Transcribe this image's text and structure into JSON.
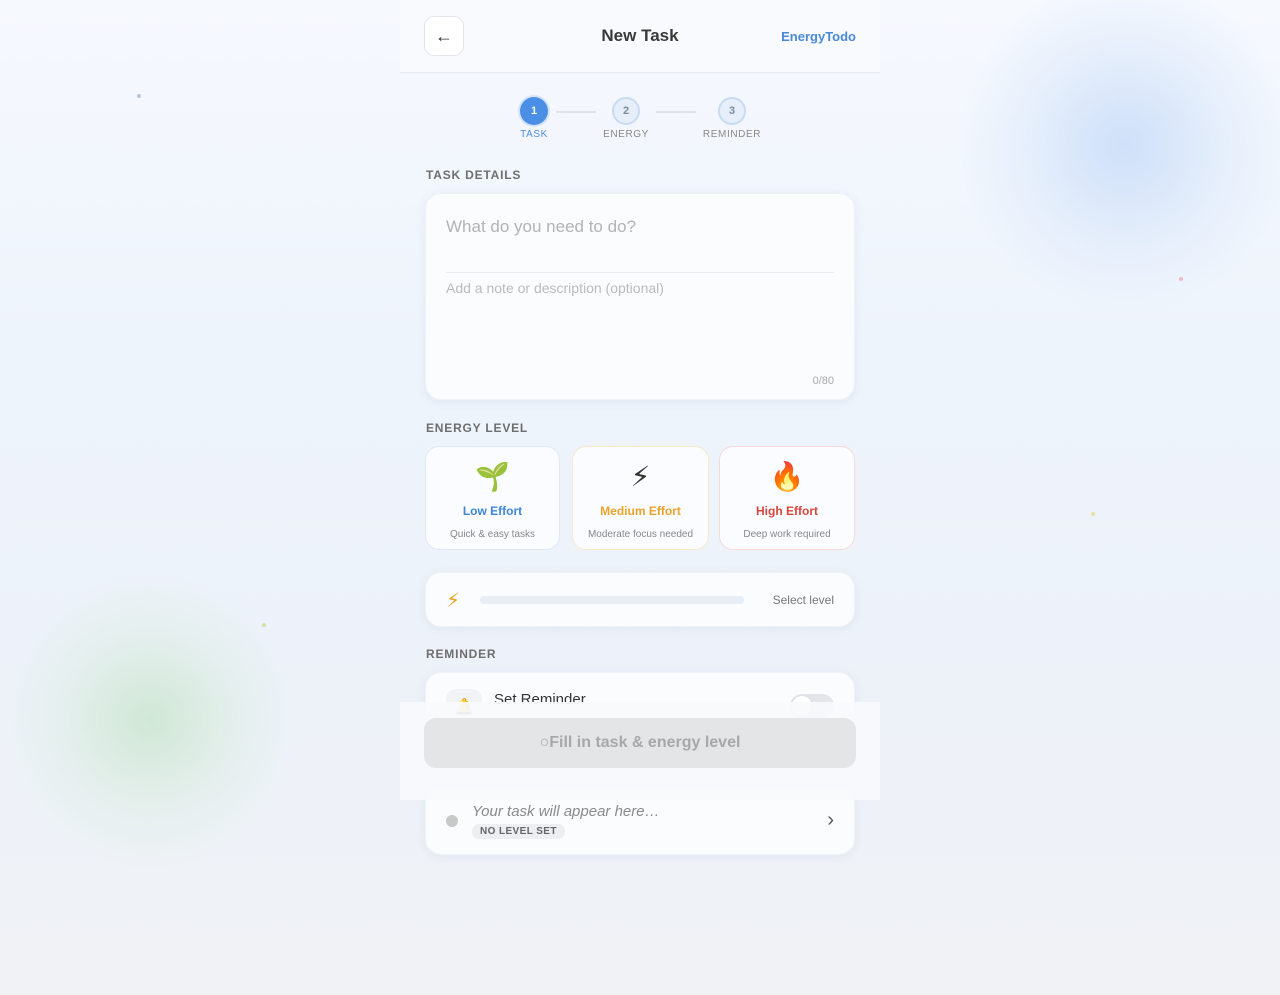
{
  "header": {
    "title": "New Task",
    "brand": "EnergyTodo",
    "back_icon": "←"
  },
  "steps": [
    {
      "number": "1",
      "label": "TASK",
      "active": true
    },
    {
      "number": "2",
      "label": "ENERGY",
      "active": false
    },
    {
      "number": "3",
      "label": "REMINDER",
      "active": false
    }
  ],
  "task_details": {
    "section_title": "TASK DETAILS",
    "title_placeholder": "What do you need to do?",
    "title_value": "",
    "note_placeholder": "Add a note or description (optional)",
    "note_value": "",
    "char_count": "0/80"
  },
  "energy_level": {
    "section_title": "ENERGY LEVEL",
    "options": [
      {
        "emoji": "🌱",
        "title": "Low Effort",
        "subtitle": "Quick & easy tasks",
        "color": "#3f86d8"
      },
      {
        "emoji": "⚡",
        "title": "Medium Effort",
        "subtitle": "Moderate focus needed",
        "color": "#e9a22a"
      },
      {
        "emoji": "🔥",
        "title": "High Effort",
        "subtitle": "Deep work required",
        "color": "#d6463c"
      }
    ],
    "meter": {
      "icon": "⚡",
      "status": "Select level",
      "fill_fraction": 0
    }
  },
  "reminder": {
    "section_title": "REMINDER",
    "icon": "🔔",
    "title": "Set Reminder",
    "toggle_on": false
  },
  "preview": {
    "text": "Your task will appear here…",
    "badge": "NO LEVEL SET",
    "chevron": "›"
  },
  "submit": {
    "label": "○Fill in task & energy level"
  }
}
